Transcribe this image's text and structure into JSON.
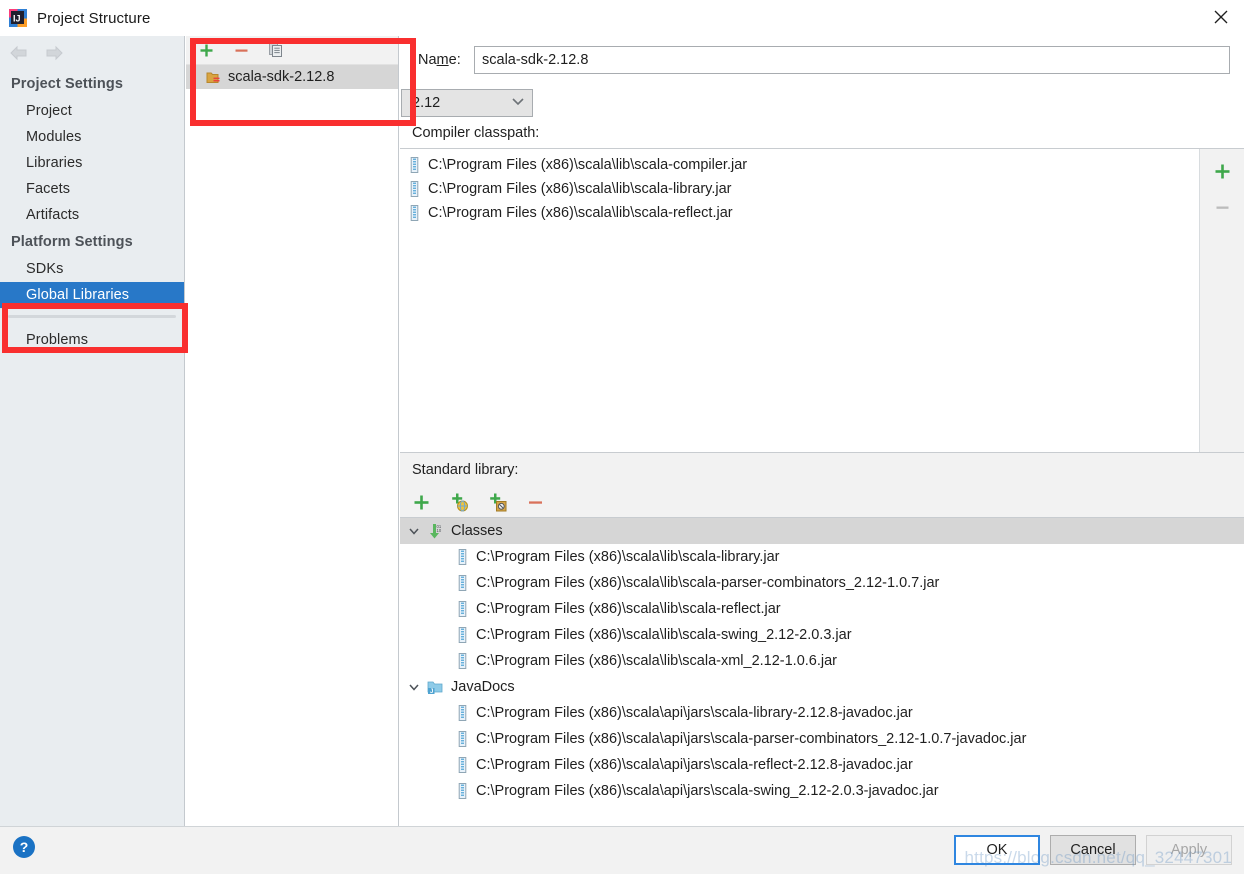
{
  "window": {
    "title": "Project Structure",
    "app_icon": "intellij-idea-logo",
    "close_label": "×"
  },
  "nav": {
    "back_icon": "arrow-left-icon",
    "forward_icon": "arrow-right-icon"
  },
  "sidebar": {
    "groups": [
      {
        "label": "Project Settings",
        "items": [
          {
            "label": "Project",
            "selected": false
          },
          {
            "label": "Modules",
            "selected": false
          },
          {
            "label": "Libraries",
            "selected": false
          },
          {
            "label": "Facets",
            "selected": false
          },
          {
            "label": "Artifacts",
            "selected": false
          }
        ]
      },
      {
        "label": "Platform Settings",
        "items": [
          {
            "label": "SDKs",
            "selected": false
          },
          {
            "label": "Global Libraries",
            "selected": true
          }
        ]
      }
    ],
    "trailing_items": [
      {
        "label": "Problems",
        "selected": false
      }
    ]
  },
  "library_pane": {
    "toolbar": [
      {
        "name": "add-library-button",
        "icon": "plus-icon"
      },
      {
        "name": "remove-library-button",
        "icon": "minus-icon"
      },
      {
        "name": "copy-library-button",
        "icon": "copy-icon"
      }
    ],
    "items": [
      {
        "label": "scala-sdk-2.12.8",
        "icon": "scala-library-icon",
        "selected": true
      }
    ]
  },
  "details": {
    "name_label_pre": "Na",
    "name_label_mnemonic": "m",
    "name_label_post": "e:",
    "name_value": "scala-sdk-2.12.8",
    "language_level": "2.12",
    "language_level_chevron": "⌄",
    "compiler_classpath_label": "Compiler classpath:",
    "compiler_classpath": [
      "C:\\Program Files (x86)\\scala\\lib\\scala-compiler.jar",
      "C:\\Program Files (x86)\\scala\\lib\\scala-library.jar",
      "C:\\Program Files (x86)\\scala\\lib\\scala-reflect.jar"
    ],
    "classpath_side_buttons": [
      {
        "name": "add-classpath-button",
        "icon": "plus-icon",
        "enabled": true
      },
      {
        "name": "remove-classpath-button",
        "icon": "minus-icon",
        "enabled": false
      }
    ],
    "standard_library_label": "Standard library:",
    "standard_library_toolbar": [
      {
        "name": "add-root-button",
        "icon": "plus-icon"
      },
      {
        "name": "add-from-url-button",
        "icon": "plus-globe-icon"
      },
      {
        "name": "attach-files-button",
        "icon": "plus-attach-icon"
      },
      {
        "name": "remove-root-button",
        "icon": "minus-icon"
      }
    ],
    "tree": [
      {
        "label": "Classes",
        "icon": "classes-icon",
        "expand_icon": "chevron-down-icon",
        "shaded": true,
        "children": [
          "C:\\Program Files (x86)\\scala\\lib\\scala-library.jar",
          "C:\\Program Files (x86)\\scala\\lib\\scala-parser-combinators_2.12-1.0.7.jar",
          "C:\\Program Files (x86)\\scala\\lib\\scala-reflect.jar",
          "C:\\Program Files (x86)\\scala\\lib\\scala-swing_2.12-2.0.3.jar",
          "C:\\Program Files (x86)\\scala\\lib\\scala-xml_2.12-1.0.6.jar"
        ]
      },
      {
        "label": "JavaDocs",
        "icon": "javadocs-folder-icon",
        "expand_icon": "chevron-down-icon",
        "shaded": false,
        "children": [
          "C:\\Program Files (x86)\\scala\\api\\jars\\scala-library-2.12.8-javadoc.jar",
          "C:\\Program Files (x86)\\scala\\api\\jars\\scala-parser-combinators_2.12-1.0.7-javadoc.jar",
          "C:\\Program Files (x86)\\scala\\api\\jars\\scala-reflect-2.12.8-javadoc.jar",
          "C:\\Program Files (x86)\\scala\\api\\jars\\scala-swing_2.12-2.0.3-javadoc.jar"
        ]
      }
    ]
  },
  "footer": {
    "help_icon": "help-question-icon",
    "ok_label": "OK",
    "cancel_label": "Cancel",
    "apply_label": "Apply",
    "watermark": "https://blog.csdn.net/qq_32447301"
  },
  "annotations": [
    {
      "name": "highlight-library-list",
      "color": "#f92f2f"
    },
    {
      "name": "highlight-global-libraries",
      "color": "#f92f2f"
    }
  ],
  "colors": {
    "accent_blue": "#2878c8",
    "annotation_red": "#f92f2f",
    "sidebar_bg": "#e9edf0",
    "panel_bg": "#f2f2f2",
    "green": "#3fa84b",
    "red_minus": "#d9715a"
  }
}
